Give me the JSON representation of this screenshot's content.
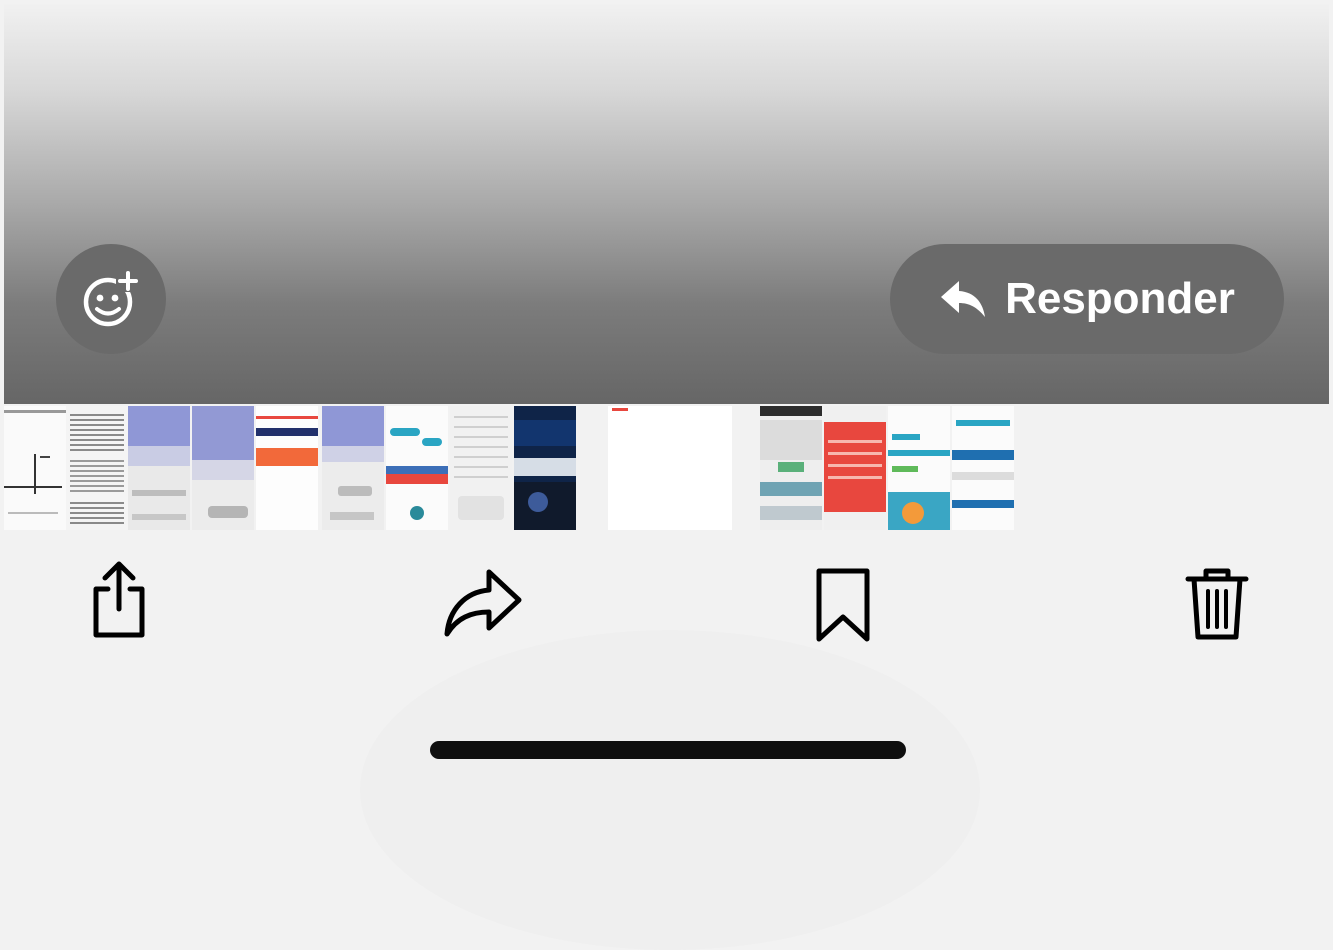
{
  "viewer": {
    "react_icon": "emoji-plus-icon",
    "reply": {
      "icon": "reply-arrow-icon",
      "label": "Responder"
    }
  },
  "thumbnails": [
    {
      "name": "thumb-chart"
    },
    {
      "name": "thumb-text-doc"
    },
    {
      "name": "thumb-lavender-1"
    },
    {
      "name": "thumb-lavender-2"
    },
    {
      "name": "thumb-orange-banner"
    },
    {
      "name": "thumb-lavender-3"
    },
    {
      "name": "thumb-chat-teal"
    },
    {
      "name": "thumb-settings"
    },
    {
      "name": "thumb-dark-photo"
    },
    {
      "name": "thumb-blank-page"
    },
    {
      "name": "thumb-web-page"
    },
    {
      "name": "thumb-red-slide"
    },
    {
      "name": "thumb-chat-green"
    },
    {
      "name": "thumb-blue-form"
    }
  ],
  "toolbar": {
    "share_icon": "share-icon",
    "forward_icon": "forward-icon",
    "bookmark_icon": "bookmark-icon",
    "delete_icon": "trash-icon"
  },
  "colors": {
    "accent_teal": "#2aa5c3",
    "accent_orange": "#f2693a",
    "accent_red": "#e8473e",
    "lavender": "#8f97d6"
  }
}
